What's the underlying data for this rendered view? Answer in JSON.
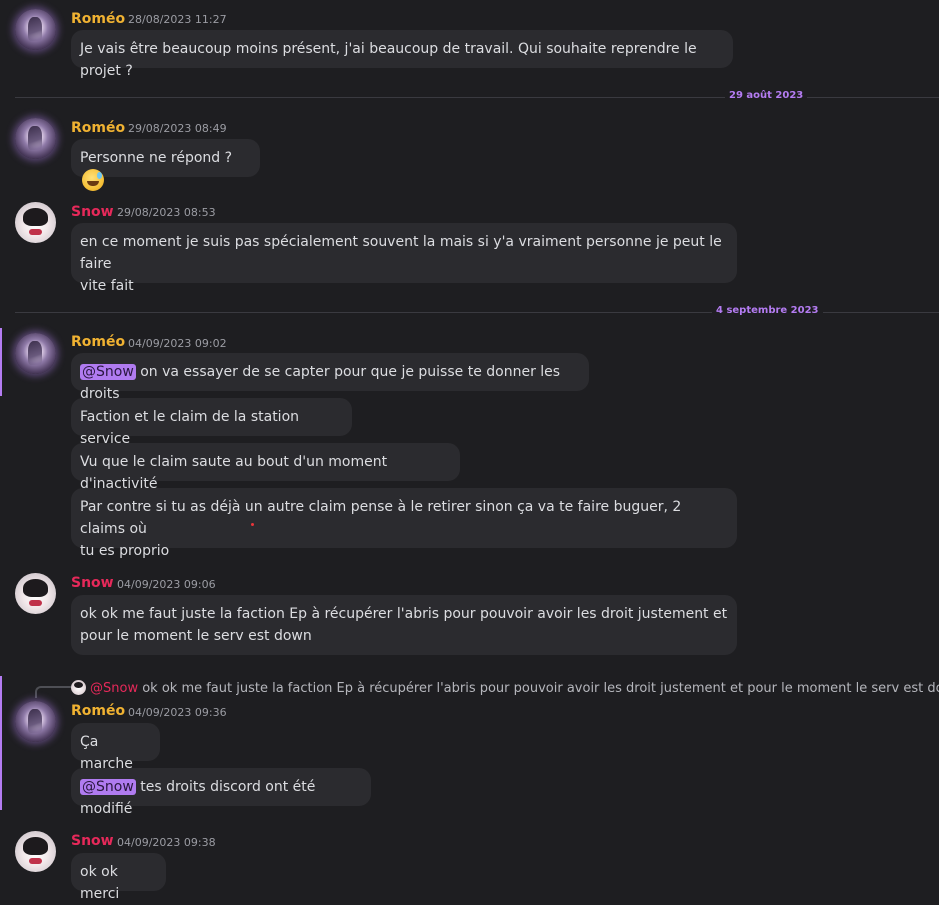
{
  "messages": [
    {
      "author": "Roméo",
      "timestamp": "28/08/2023 11:27",
      "lines": [
        "Je vais être beaucoup moins présent, j'ai beaucoup de travail. Qui souhaite reprendre le projet ?"
      ]
    },
    {
      "author": "Roméo",
      "timestamp": "29/08/2023 08:49",
      "lines": [
        "Personne ne répond ?"
      ],
      "emoji": "sweat-smile"
    },
    {
      "author": "Snow",
      "timestamp": "29/08/2023 08:53",
      "lines": [
        "en ce moment je suis pas spécialement souvent la mais si y'a vraiment personne je peut le faire",
        "vite fait"
      ]
    },
    {
      "author": "Roméo",
      "timestamp": "04/09/2023 09:02",
      "mention": "@Snow",
      "lines": [
        " on va essayer de se capter pour que je puisse te donner les droits",
        "Faction et le claim de la station service",
        "Vu que le claim saute au bout d'un moment d'inactivité",
        "Par contre si tu as déjà un autre claim pense à le retirer sinon ça va te faire buguer, 2 claims où",
        "tu es proprio"
      ]
    },
    {
      "author": "Snow",
      "timestamp": "04/09/2023 09:06",
      "lines": [
        "ok ok me faut juste la faction Ep à récupérer l'abris pour pouvoir avoir les droit justement et",
        "pour le moment le serv est down"
      ]
    },
    {
      "author": "Roméo",
      "timestamp": "04/09/2023 09:36",
      "reply": {
        "author": "@Snow",
        "text": " ok ok me faut juste la faction Ep à récupérer l'abris pour pouvoir avoir les droit justement et pour le moment le serv est down"
      },
      "mention": "@Snow",
      "lines": [
        "Ça marche",
        " tes droits discord ont été modifié"
      ]
    },
    {
      "author": "Snow",
      "timestamp": "04/09/2023 09:38",
      "lines": [
        "ok ok merci"
      ]
    }
  ],
  "dividers": [
    "29 août 2023",
    "4 septembre 2023"
  ],
  "colors": {
    "background": "#1e1e21",
    "bubble": "#2b2b2f",
    "romeo": "#f0b232",
    "snow": "#e6295a",
    "accent": "#b47cf2"
  }
}
